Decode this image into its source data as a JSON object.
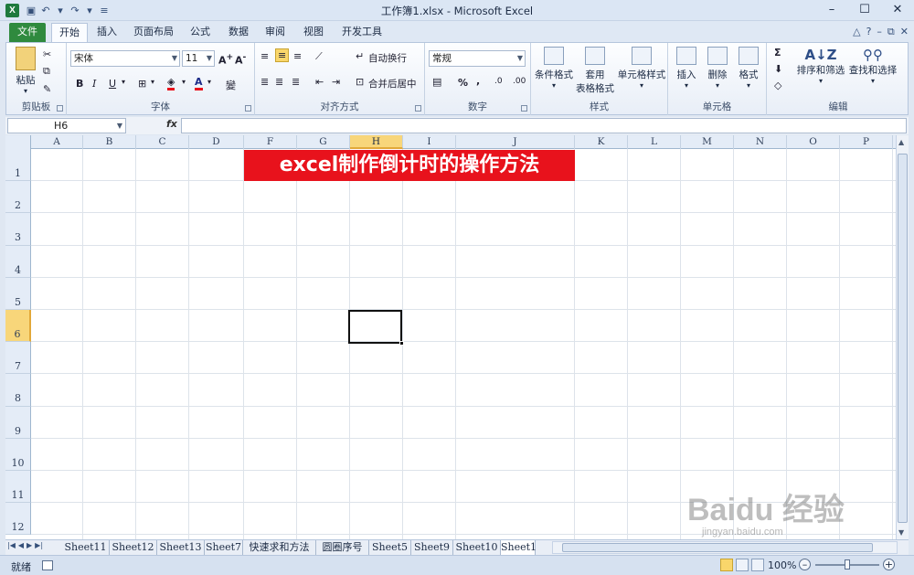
{
  "window": {
    "title": "工作簿1.xlsx - Microsoft Excel",
    "app_icon_letter": "X"
  },
  "tabs": [
    {
      "label": "文件"
    },
    {
      "label": "开始"
    },
    {
      "label": "插入"
    },
    {
      "label": "页面布局"
    },
    {
      "label": "公式"
    },
    {
      "label": "数据"
    },
    {
      "label": "审阅"
    },
    {
      "label": "视图"
    },
    {
      "label": "开发工具"
    }
  ],
  "ribbon": {
    "clipboard": {
      "paste": "粘贴",
      "group": "剪贴板"
    },
    "font": {
      "name": "宋体",
      "size": "11",
      "group": "字体",
      "bold": "B",
      "italic": "I",
      "underline": "U"
    },
    "alignment": {
      "wrap": "自动换行",
      "merge": "合并后居中",
      "group": "对齐方式"
    },
    "number": {
      "format": "常规",
      "group": "数字",
      "percent": "%",
      "comma": ","
    },
    "styles": {
      "conditional": "条件格式",
      "table_line1": "套用",
      "table_line2": "表格格式",
      "cell_styles": "单元格样式",
      "group": "样式"
    },
    "cells": {
      "insert": "插入",
      "delete": "删除",
      "format": "格式",
      "group": "单元格"
    },
    "editing": {
      "sort": "排序和筛选",
      "find": "查找和选择",
      "group": "编辑",
      "sum": "Σ"
    }
  },
  "formula_bar": {
    "name_box": "H6",
    "fx": "fx",
    "value": ""
  },
  "columns": [
    "A",
    "B",
    "C",
    "D",
    "F",
    "G",
    "H",
    "I",
    "J",
    "K",
    "L",
    "M",
    "N",
    "O",
    "P"
  ],
  "rows": [
    "1",
    "2",
    "3",
    "4",
    "5",
    "6",
    "7",
    "8",
    "9",
    "10",
    "11",
    "12"
  ],
  "selected_cell": {
    "column": "H",
    "row": "6"
  },
  "banner_text": "excel制作倒计时的操作方法",
  "sheets": [
    "Sheet11",
    "Sheet12",
    "Sheet13",
    "Sheet7",
    "快速求和方法",
    "圆圈序号",
    "Sheet5",
    "Sheet9",
    "Sheet10",
    "Sheet1"
  ],
  "active_sheet": "Sheet1",
  "status": {
    "mode": "就绪",
    "zoom": "100%"
  },
  "watermark": {
    "main": "Baidu 经验",
    "sub": "jingyan.baidu.com"
  },
  "colors": {
    "banner_bg": "#e8121c",
    "file_tab": "#2f8a3e",
    "selection_header": "#f8d67a"
  }
}
